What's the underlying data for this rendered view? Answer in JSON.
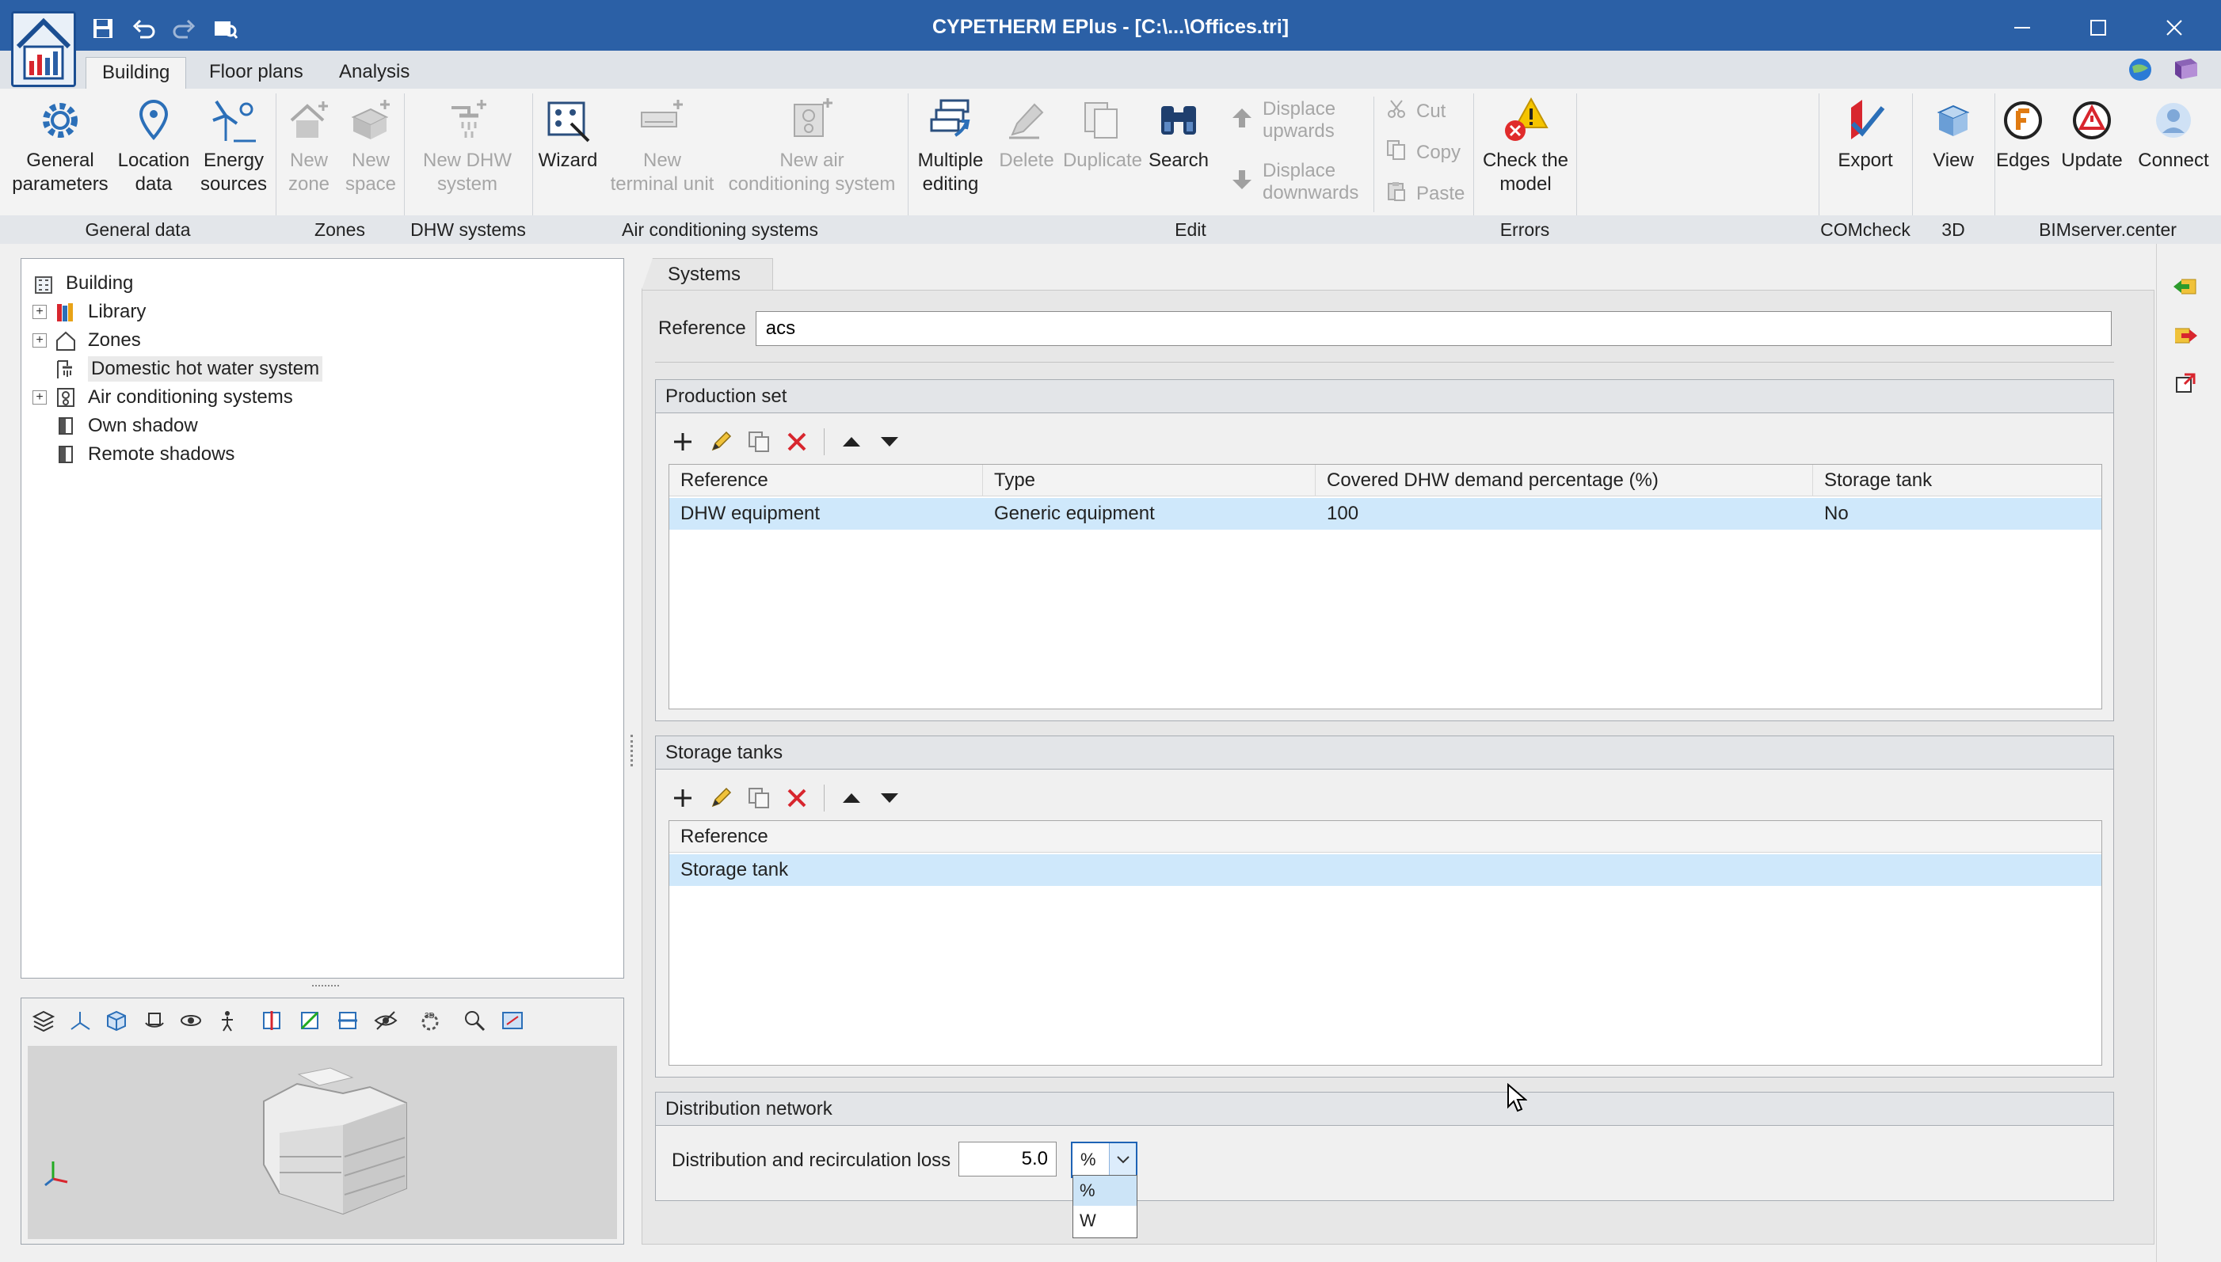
{
  "window": {
    "title": "CYPETHERM EPlus - [C:\\...\\Offices.tri]"
  },
  "ribbon_tabs": [
    {
      "label": "Building",
      "active": true
    },
    {
      "label": "Floor plans",
      "active": false
    },
    {
      "label": "Analysis",
      "active": false
    }
  ],
  "ribbon": {
    "general_data": {
      "label": "General data",
      "general_parameters": "General\nparameters",
      "location_data": "Location\ndata",
      "energy_sources": "Energy\nsources"
    },
    "zones": {
      "label": "Zones",
      "new_zone": "New\nzone",
      "new_space": "New\nspace"
    },
    "dhw": {
      "label": "DHW systems",
      "new_dhw_system": "New DHW\nsystem"
    },
    "air": {
      "label": "Air conditioning systems",
      "wizard": "Wizard",
      "new_terminal_unit": "New\nterminal unit",
      "new_air_system": "New air\nconditioning system"
    },
    "edit": {
      "label": "Edit",
      "multiple_editing": "Multiple\nediting",
      "delete": "Delete",
      "duplicate": "Duplicate",
      "search": "Search",
      "displace_upwards": "Displace\nupwards",
      "displace_downwards": "Displace\ndownwards",
      "cut": "Cut",
      "copy": "Copy",
      "paste": "Paste"
    },
    "errors": {
      "label": "Errors",
      "check_model": "Check the\nmodel"
    },
    "comcheck": {
      "label": "COMcheck",
      "export": "Export"
    },
    "view3d": {
      "label": "3D",
      "view": "View"
    },
    "bimserver": {
      "label": "BIMserver.center",
      "edges": "Edges",
      "update": "Update",
      "connect": "Connect"
    }
  },
  "tree": {
    "root": "Building",
    "items": [
      {
        "label": "Library",
        "expandable": true
      },
      {
        "label": "Zones",
        "expandable": true
      },
      {
        "label": "Domestic hot water system",
        "expandable": false,
        "selected": true
      },
      {
        "label": "Air conditioning systems",
        "expandable": true
      },
      {
        "label": "Own shadow",
        "expandable": false
      },
      {
        "label": "Remote shadows",
        "expandable": false
      }
    ]
  },
  "systems": {
    "tab_label": "Systems",
    "reference_label": "Reference",
    "reference_value": "acs",
    "production_set": {
      "title": "Production set",
      "columns": [
        "Reference",
        "Type",
        "Covered DHW demand percentage (%)",
        "Storage tank"
      ],
      "rows": [
        [
          "DHW equipment",
          "Generic equipment",
          "100",
          "No"
        ]
      ]
    },
    "storage_tanks": {
      "title": "Storage tanks",
      "columns": [
        "Reference"
      ],
      "rows": [
        [
          "Storage tank"
        ]
      ]
    },
    "distribution": {
      "title": "Distribution network",
      "loss_label": "Distribution and recirculation loss",
      "loss_value": "5.0",
      "unit_selected": "%",
      "unit_options": [
        "%",
        "W"
      ]
    }
  },
  "colors": {
    "title_bar": "#2b60a6",
    "selection": "#cfe8fb",
    "accent": "#1e63b5"
  }
}
